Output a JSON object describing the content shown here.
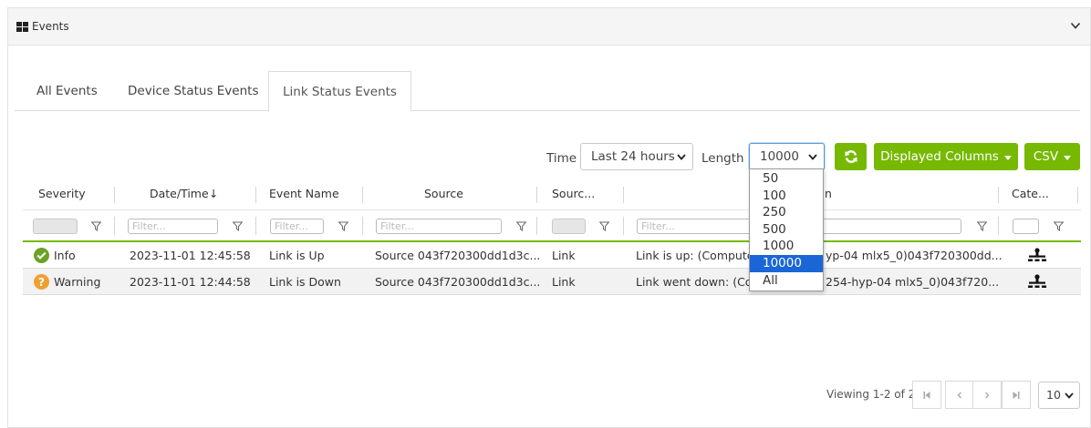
{
  "panel": {
    "title": "Events"
  },
  "tabs": [
    {
      "label": "All Events"
    },
    {
      "label": "Device Status Events"
    },
    {
      "label": "Link Status Events",
      "active": true
    }
  ],
  "toolbar": {
    "time_label": "Time",
    "time_value": "Last 24 hours",
    "length_label": "Length",
    "length_value": "10000",
    "refresh_icon": "refresh-icon",
    "displayed_columns_label": "Displayed Columns",
    "csv_label": "CSV",
    "accent_color": "#76b900"
  },
  "length_options": [
    "50",
    "100",
    "250",
    "500",
    "1000",
    "10000",
    "All"
  ],
  "length_selected": "10000",
  "table": {
    "columns": [
      "Severity",
      "Date/Time",
      "Event Name",
      "Source",
      "Sourc...",
      "n",
      "Cate..."
    ],
    "sort_indicator": "↓",
    "filter_placeholder": "Filter...",
    "rows": [
      {
        "severity": "Info",
        "severity_icon": "check-circle-icon",
        "severity_color": "#6aa324",
        "datetime": "2023-11-01 12:45:58",
        "event_name": "Link is Up",
        "source": "Source 043f720300dd1d3c...",
        "source_type": "Link",
        "description_left": "Link is up: (Compute",
        "description_right": "yp-04 mlx5_0)043f720300dd...",
        "category_icon": "network-icon"
      },
      {
        "severity": "Warning",
        "severity_icon": "question-circle-icon",
        "severity_color": "#f0a030",
        "datetime": "2023-11-01 12:44:58",
        "event_name": "Link is Down",
        "source": "Source 043f720300dd1d3c...",
        "source_type": "Link",
        "description_left": "Link went down: (Co",
        "description_right": "254-hyp-04 mlx5_0)043f720...",
        "category_icon": "network-icon"
      }
    ]
  },
  "pagination": {
    "viewing_text": "Viewing 1-2 of 2",
    "page_size": "10"
  }
}
